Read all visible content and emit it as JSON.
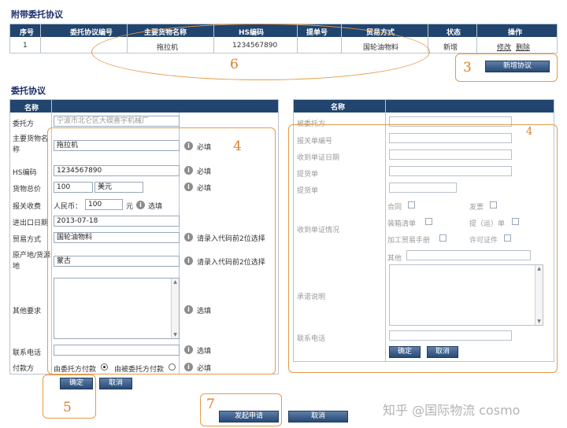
{
  "attached": {
    "title": "附带委托协议",
    "headers": [
      "序号",
      "委托协议编号",
      "主要货物名称",
      "HS编码",
      "提单号",
      "贸易方式",
      "状态",
      "操作"
    ],
    "row": {
      "seq": "1",
      "goods": "拖拉机",
      "hs": "1234567890",
      "trade": "国轮油物料",
      "status": "新增",
      "edit": "修改",
      "delete": "删除"
    },
    "add_button": "新增协议"
  },
  "agreement": {
    "title": "委托协议",
    "left_header": "名称",
    "fields": {
      "client_label": "委托方",
      "client_value": "宁波市北仑区大碶喜宇机械厂",
      "goods_label": "主要货物名称",
      "goods_value": "拖拉机",
      "hs_label": "HS编码",
      "hs_value": "1234567890",
      "total_label": "货物总价",
      "total_value": "100",
      "currency_value": "美元",
      "fee_label": "报关收费",
      "fee_prefix": "人民币：",
      "fee_value": "100",
      "fee_unit": "元",
      "ie_date_label": "进出口日期",
      "ie_date_value": "2013-07-18",
      "trade_label": "贸易方式",
      "trade_value": "国轮油物料",
      "origin_label": "原产地/货源地",
      "origin_value": "蒙古",
      "other_label": "其他要求",
      "phone_label": "联系电话",
      "pay_label": "付款方",
      "pay_opt1": "由委托方付款",
      "pay_opt2": "由被委托方付款"
    },
    "hints": {
      "required": "必填",
      "optional": "选填",
      "code_hint": "请录入代码前2位选择"
    },
    "ok_button": "确定",
    "cancel_button": "取消"
  },
  "right_panel": {
    "header": "名称",
    "fields": {
      "trustee": "被委托方",
      "decl_no": "报关单编号",
      "recv_date": "收到单证日期",
      "bill1": "提货单",
      "bill2": "提货单",
      "recv_status": "收到单证情况",
      "other": "其他",
      "promise": "承诺说明",
      "phone": "联系电话"
    },
    "checks": {
      "contract": "合同",
      "invoice": "发票",
      "packing": "装箱清单",
      "bol": "提（运）单",
      "manual": "加工贸易手册",
      "license": "许可证件"
    },
    "ok_button": "确定",
    "cancel_button": "取消"
  },
  "bottom": {
    "submit_button": "发起申请",
    "cancel_button": "取消"
  },
  "annotations": {
    "n3": "3",
    "n4a": "4",
    "n4b": "4",
    "n5": "5",
    "n6": "6",
    "n7": "7"
  },
  "watermark": "知乎 @国际物流 cosmo"
}
